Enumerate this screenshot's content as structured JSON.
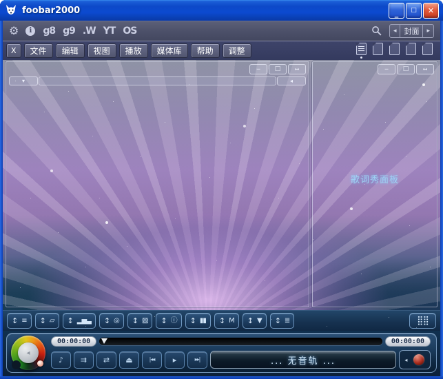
{
  "window": {
    "title": "foobar2000"
  },
  "titlebar": {
    "minimize_glyph": "_",
    "maximize_glyph": "□",
    "close_glyph": "✕"
  },
  "toolbar": {
    "icons": [
      {
        "name": "preferences-gear-icon",
        "glyph": "⚙"
      },
      {
        "name": "info-icon",
        "glyph": "i"
      },
      {
        "name": "google-icon",
        "glyph": "g8"
      },
      {
        "name": "google-images-icon",
        "glyph": "g9"
      },
      {
        "name": "wikipedia-icon",
        "glyph": ".W"
      },
      {
        "name": "youtube-icon",
        "glyph": "YT"
      },
      {
        "name": "allmusic-icon",
        "glyph": "OS"
      }
    ],
    "cover_selector": {
      "prev_glyph": "◂",
      "label": "封面",
      "next_glyph": "▸"
    }
  },
  "menubar": {
    "items": [
      "X",
      "文件",
      "编辑",
      "视图",
      "播放",
      "媒体库",
      "帮助",
      "调整"
    ],
    "playlist_tab_count": 5
  },
  "panels": {
    "controls": {
      "minimize_glyph": "─",
      "maximize_glyph": "□",
      "expand_glyph": "↔"
    },
    "left": {
      "scroll_down_glyph": "▾",
      "scroll_left_glyph": "◂"
    },
    "right": {
      "label": "歌词秀面板"
    }
  },
  "bottom_toolbar": {
    "updown_glyph": "↕",
    "buttons": [
      {
        "name": "playlist-manager",
        "glyph": "≡"
      },
      {
        "name": "selection-properties",
        "glyph": "▱"
      },
      {
        "name": "spectrum-visualizer",
        "glyph": "▂▅▃"
      },
      {
        "name": "spiral-visualizer",
        "glyph": "◎"
      },
      {
        "name": "album-art-panel",
        "glyph": "▨"
      },
      {
        "name": "track-info-panel",
        "glyph": "ⓘ"
      },
      {
        "name": "vu-meter-panel",
        "glyph": "▮▮"
      },
      {
        "name": "peak-meter-panel",
        "glyph": "M"
      },
      {
        "name": "filter-panel",
        "glyph": "▼"
      },
      {
        "name": "playlist-view-panel",
        "glyph": "≣"
      }
    ],
    "matrix_glyph": "⣿⣿"
  },
  "player": {
    "elapsed": "00:00:00",
    "total": "00:00:00",
    "track_display": "... 无音轨 ...",
    "knob_pointer_glyph": "◂",
    "transport": [
      {
        "name": "note-button",
        "glyph": "♪"
      },
      {
        "name": "playback-order-button",
        "glyph": "⇉"
      },
      {
        "name": "shuffle-button",
        "glyph": "⇄"
      },
      {
        "name": "eject-button",
        "glyph": "⏏"
      },
      {
        "name": "previous-button",
        "glyph": "|◂◂"
      },
      {
        "name": "play-button",
        "glyph": "▸"
      },
      {
        "name": "next-button",
        "glyph": "▸▸|"
      }
    ],
    "volume_flyout_glyph": "◂"
  }
}
